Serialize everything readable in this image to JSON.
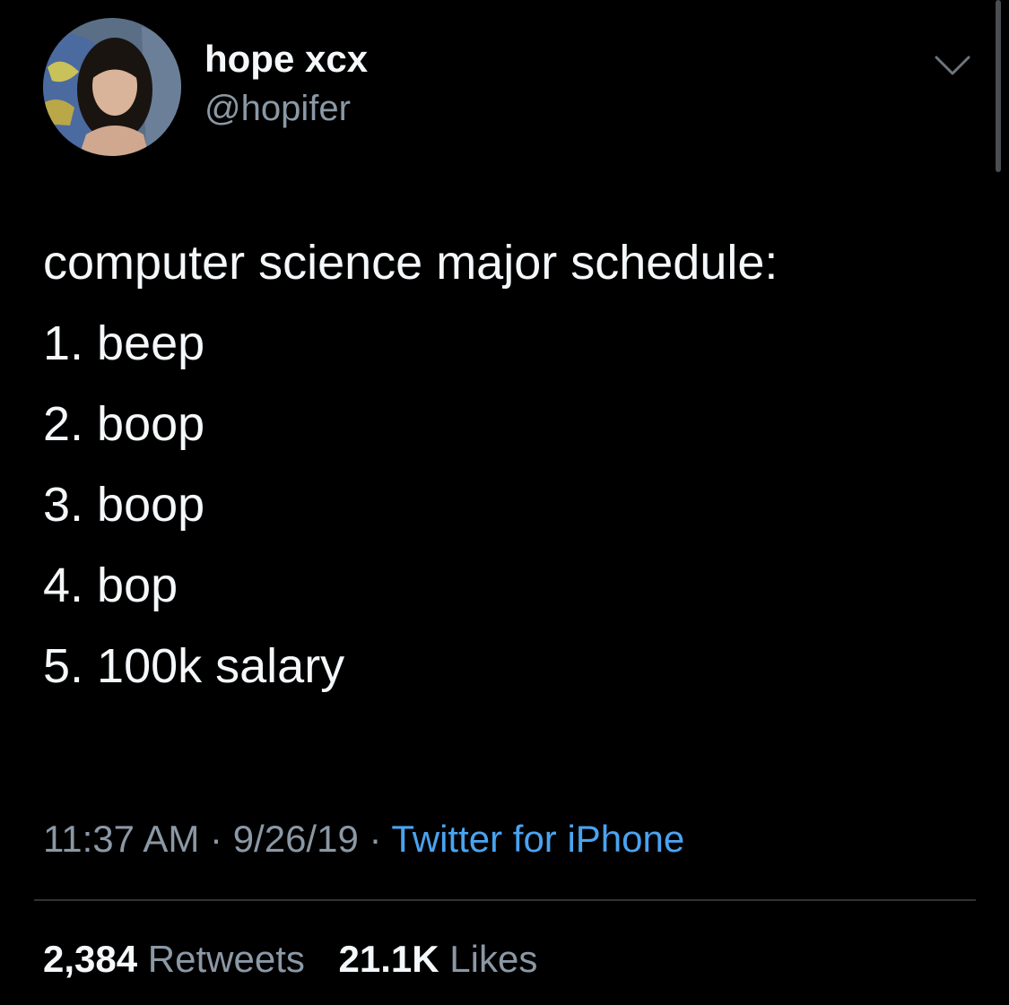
{
  "user": {
    "display_name": "hope xcx",
    "handle": "@hopifer"
  },
  "tweet": {
    "lines": [
      "computer science major schedule:",
      "1. beep",
      "2. boop",
      "3. boop",
      "4. bop",
      "5. 100k salary"
    ],
    "time": "11:37 AM",
    "date": "9/26/19",
    "separator": "·",
    "source": "Twitter for iPhone"
  },
  "stats": {
    "retweets_count": "2,384",
    "retweets_label": "Retweets",
    "likes_count": "21.1K",
    "likes_label": "Likes"
  },
  "icons": {
    "menu": "chevron-down-icon"
  },
  "colors": {
    "background": "#000000",
    "text_primary": "#f5f8fa",
    "text_secondary": "#8b98a5",
    "link": "#4aa3f0",
    "divider": "#2f3336"
  }
}
